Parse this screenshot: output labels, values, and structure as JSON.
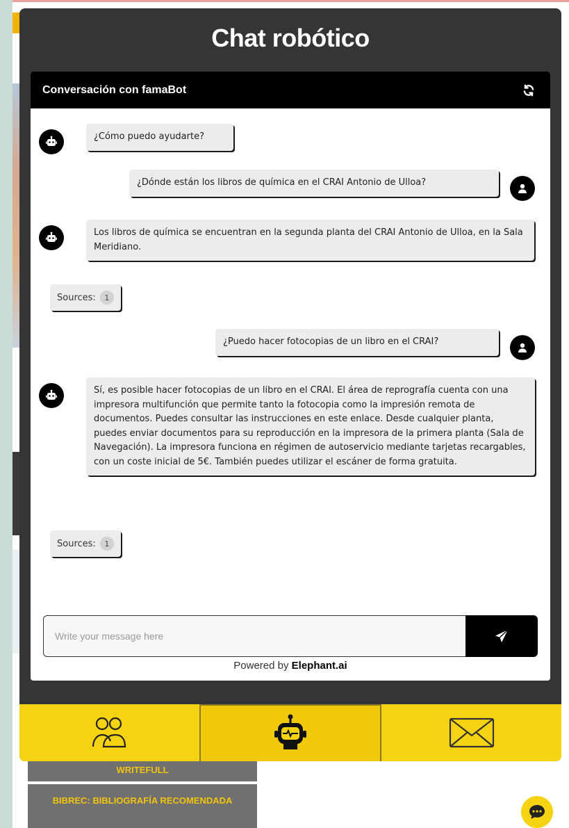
{
  "widget": {
    "title": "Chat robótico"
  },
  "chat": {
    "header_title": "Conversación con famaBot",
    "messages": [
      {
        "role": "bot",
        "text": "¿Cómo puedo ayudarte?"
      },
      {
        "role": "user",
        "text": "¿Dónde están los libros de química en el CRAI Antonio de Ulloa?"
      },
      {
        "role": "bot",
        "text": "Los libros de química se encuentran en la segunda planta del CRAI Antonio de Ulloa, en la Sala Meridiano."
      },
      {
        "role": "user",
        "text": "¿Puedo hacer fotocopias de un libro en el CRAI?"
      },
      {
        "role": "bot",
        "text": "Sí, es posible hacer fotocopias de un libro en el CRAI. El área de reprografía cuenta con una impresora multifunción que permite tanto la fotocopia como la impresión remota de documentos. Puedes consultar las instrucciones en este enlace. Desde cualquier planta, puedes enviar documentos para su reproducción en la impresora de la primera planta (Sala de Navegación). La impresora funciona en régimen de autoservicio mediante tarjetas recargables, con un coste inicial de 5€. También puedes utilizar el escáner de forma gratuita."
      }
    ],
    "sources": [
      {
        "label": "Sources:",
        "count": "1"
      },
      {
        "label": "Sources:",
        "count": "1"
      }
    ],
    "input_placeholder": "Write your message here",
    "powered_prefix": "Powered by",
    "powered_brand": "Elephant.ai"
  },
  "background": {
    "nav_items": [
      "WRITEFULL",
      "BIBREC: BIBLIOGRAFÍA RECOMENDADA"
    ]
  },
  "colors": {
    "accent": "#f5d312",
    "dark": "#353535",
    "bubble": "#ececec"
  }
}
